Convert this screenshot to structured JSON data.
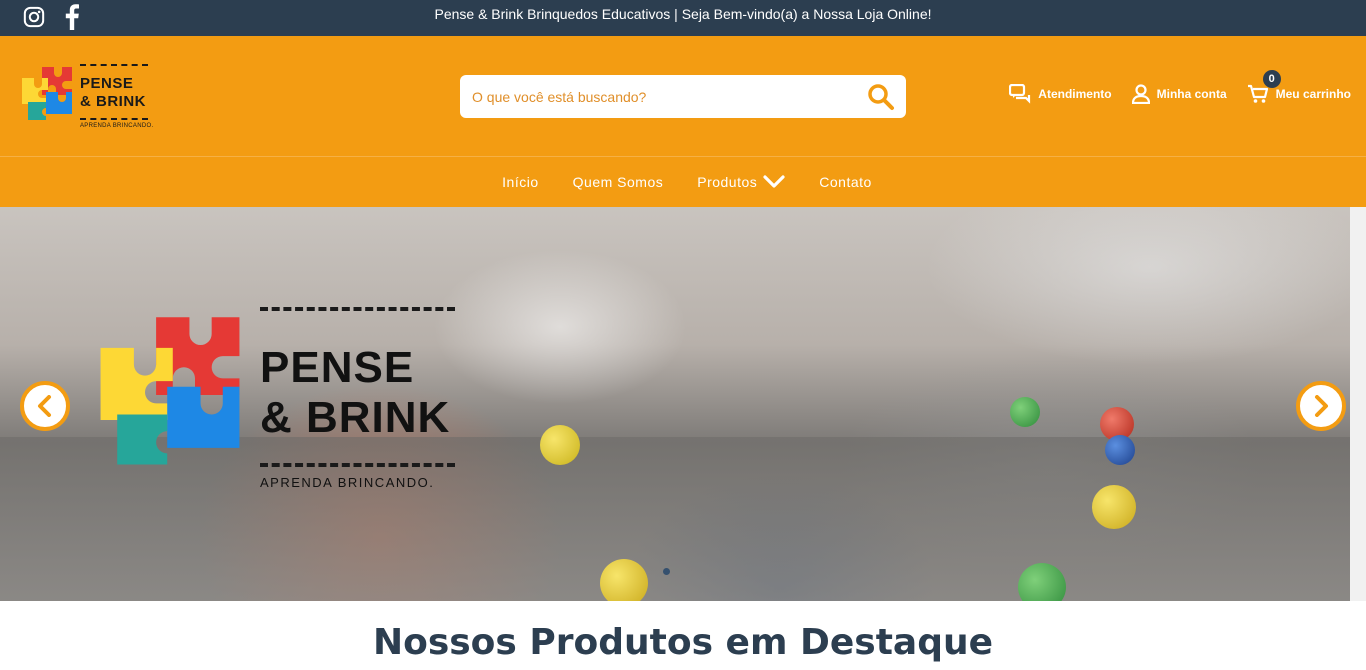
{
  "topbar": {
    "message": "Pense & Brink Brinquedos Educativos | Seja Bem-vindo(a) a Nossa Loja Online!",
    "social": [
      "instagram-icon",
      "facebook-icon"
    ],
    "background": "#2c3e50"
  },
  "header": {
    "background": "#f39c12",
    "logo": {
      "line1": "PENSE",
      "line2": "& BRINK",
      "tagline": "APRENDA BRINCANDO."
    },
    "search": {
      "placeholder": "O que você está buscando?"
    },
    "links": {
      "support": "Atendimento",
      "account": "Minha conta",
      "cart": "Meu carrinho",
      "cart_count": "0"
    }
  },
  "nav": {
    "items": [
      {
        "label": "Início"
      },
      {
        "label": "Quem Somos"
      },
      {
        "label": "Produtos"
      },
      {
        "label": "Contato"
      }
    ]
  },
  "hero": {
    "logo": {
      "line1": "PENSE",
      "line2": "& BRINK",
      "tagline": "APRENDA BRINCANDO."
    }
  },
  "featured": {
    "title": "Nossos Produtos em Destaque"
  }
}
